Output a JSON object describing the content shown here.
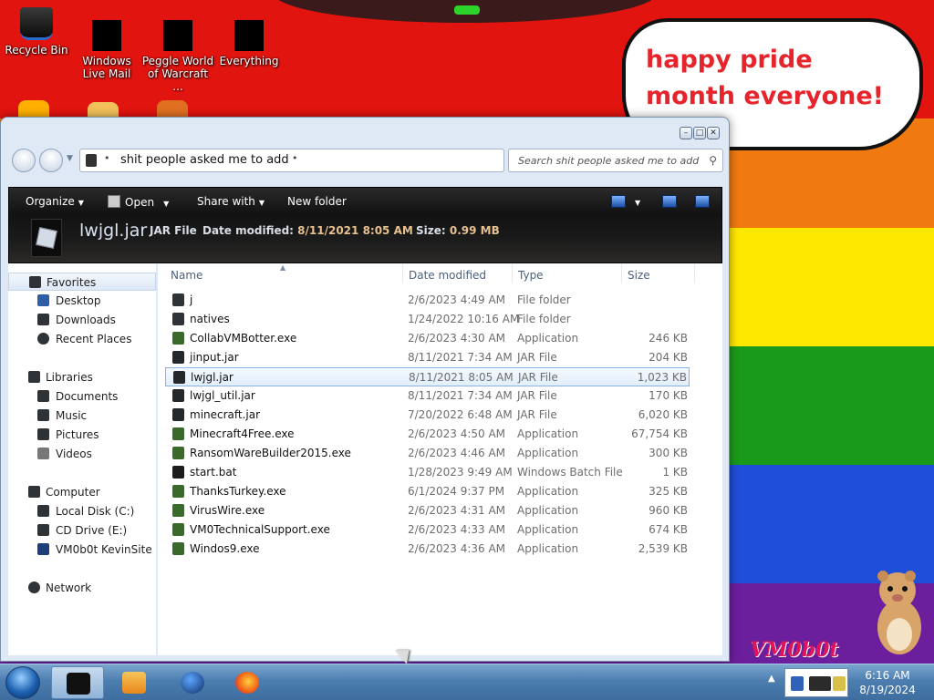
{
  "desktop": {
    "icons": [
      {
        "label": "Recycle Bin"
      },
      {
        "label": "Windows Live Mail"
      },
      {
        "label": "Peggle World of Warcraft ..."
      },
      {
        "label": "Everything"
      }
    ],
    "bubble_text": "happy pride month everyone!",
    "logo_text": "VM0b0t"
  },
  "explorer": {
    "address": {
      "path": "shit people asked me to add"
    },
    "search": {
      "placeholder": "Search shit people asked me to add"
    },
    "toolbar": {
      "organize": "Organize",
      "open": "Open",
      "share_with": "Share with",
      "new_folder": "New folder"
    },
    "details": {
      "name": "lwjgl.jar",
      "type": "JAR File",
      "modified_label": "Date modified:",
      "modified_value": "8/11/2021 8:05 AM",
      "size_label": "Size:",
      "size_value": "0.99 MB"
    },
    "nav": {
      "favorites": "Favorites",
      "desktop": "Desktop",
      "downloads": "Downloads",
      "recent": "Recent Places",
      "libraries": "Libraries",
      "documents": "Documents",
      "music": "Music",
      "pictures": "Pictures",
      "videos": "Videos",
      "computer": "Computer",
      "local_disk": "Local Disk (C:)",
      "cd_drive": "CD Drive (E:)",
      "vm0b0t_site": "VM0b0t KevinSite",
      "network": "Network"
    },
    "columns": {
      "name": "Name",
      "date": "Date modified",
      "type": "Type",
      "size": "Size"
    },
    "files": [
      {
        "name": "j",
        "date": "2/6/2023 4:49 AM",
        "type": "File folder",
        "size": "",
        "icon": "folder-icon"
      },
      {
        "name": "natives",
        "date": "1/24/2022 10:16 AM",
        "type": "File folder",
        "size": "",
        "icon": "folder-icon"
      },
      {
        "name": "CollabVMBotter.exe",
        "date": "2/6/2023 4:30 AM",
        "type": "Application",
        "size": "246 KB",
        "icon": "app-icon"
      },
      {
        "name": "jinput.jar",
        "date": "8/11/2021 7:34 AM",
        "type": "JAR File",
        "size": "204 KB",
        "icon": "jar-icon"
      },
      {
        "name": "lwjgl.jar",
        "date": "8/11/2021 8:05 AM",
        "type": "JAR File",
        "size": "1,023 KB",
        "icon": "jar-icon"
      },
      {
        "name": "lwjgl_util.jar",
        "date": "8/11/2021 7:34 AM",
        "type": "JAR File",
        "size": "170 KB",
        "icon": "jar-icon"
      },
      {
        "name": "minecraft.jar",
        "date": "7/20/2022 6:48 AM",
        "type": "JAR File",
        "size": "6,020 KB",
        "icon": "jar-icon"
      },
      {
        "name": "Minecraft4Free.exe",
        "date": "2/6/2023 4:50 AM",
        "type": "Application",
        "size": "67,754 KB",
        "icon": "app-icon"
      },
      {
        "name": "RansomWareBuilder2015.exe",
        "date": "2/6/2023 4:46 AM",
        "type": "Application",
        "size": "300 KB",
        "icon": "app-icon"
      },
      {
        "name": "start.bat",
        "date": "1/28/2023 9:49 AM",
        "type": "Windows Batch File",
        "size": "1 KB",
        "icon": "batch-file-icon"
      },
      {
        "name": "ThanksTurkey.exe",
        "date": "6/1/2024 9:37 PM",
        "type": "Application",
        "size": "325 KB",
        "icon": "app-icon"
      },
      {
        "name": "VirusWire.exe",
        "date": "2/6/2023 4:31 AM",
        "type": "Application",
        "size": "960 KB",
        "icon": "app-icon"
      },
      {
        "name": "VM0TechnicalSupport.exe",
        "date": "2/6/2023 4:33 AM",
        "type": "Application",
        "size": "674 KB",
        "icon": "app-icon"
      },
      {
        "name": "Windos9.exe",
        "date": "2/6/2023 4:36 AM",
        "type": "Application",
        "size": "2,539 KB",
        "icon": "app-icon"
      }
    ],
    "selected_index": 4
  },
  "taskbar": {
    "time": "6:16 AM",
    "date": "8/19/2024"
  },
  "colors": {
    "accent": "#3e6d9f",
    "bubble_text": "#e5242c",
    "selection": "#e2eefc"
  }
}
